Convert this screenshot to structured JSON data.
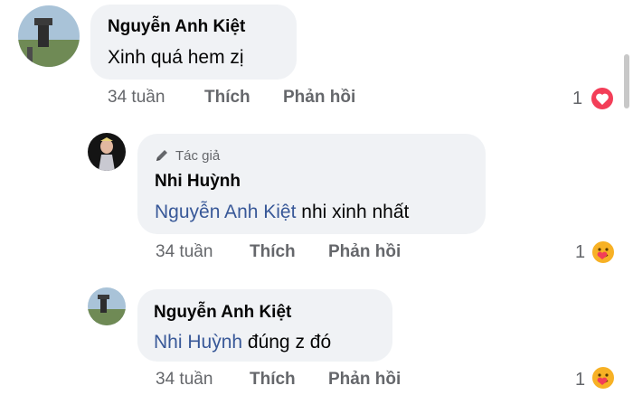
{
  "comments": [
    {
      "author": "Nguyễn Anh Kiệt",
      "text": "Xinh quá hem zị",
      "time": "34 tuần",
      "like_label": "Thích",
      "reply_label": "Phản hồi",
      "reaction_count": "1",
      "reaction": "love-icon"
    }
  ],
  "replies": [
    {
      "author_badge": "Tác giả",
      "author": "Nhi Huỳnh",
      "mention": "Nguyễn Anh Kiệt",
      "text": " nhi xinh nhất",
      "time": "34 tuần",
      "like_label": "Thích",
      "reply_label": "Phản hồi",
      "reaction_count": "1",
      "reaction": "care-icon"
    },
    {
      "author": "Nguyễn Anh Kiệt",
      "mention": "Nhi Huỳnh",
      "text": " đúng z đó",
      "time": "34 tuần",
      "like_label": "Thích",
      "reply_label": "Phản hồi",
      "reaction_count": "1",
      "reaction": "care-icon"
    }
  ],
  "colors": {
    "bubble": "#f0f2f5",
    "mention": "#385898",
    "meta": "#65676b",
    "love": "#f33e58",
    "care": "#f7b125"
  }
}
